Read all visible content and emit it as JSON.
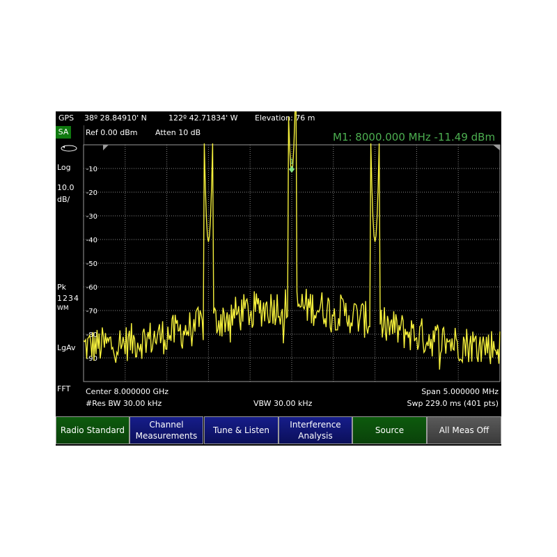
{
  "gps": {
    "label": "GPS",
    "lat": "38º 28.84910' N",
    "lon": "122º 42.71834' W",
    "elevation": "Elevation: 76 m"
  },
  "mode_badge": "SA",
  "header": {
    "ref": "Ref 0.00 dBm",
    "atten": "Atten 10 dB",
    "marker": "M1:  8000.000 MHz  -11.49 dBm"
  },
  "left_panel": {
    "scale_type": "Log",
    "scale_value": "10.0",
    "scale_unit": "dB/",
    "detector": "Pk",
    "traces": "1234",
    "trace_mode": "WM",
    "average": "LgAv",
    "sweep_type": "FFT"
  },
  "footer": {
    "center": "Center 8.000000 GHz",
    "span": "Span 5.000000 MHz",
    "rbw": "#Res BW 30.00 kHz",
    "vbw": "VBW 30.00 kHz",
    "sweep": "Swp 229.0 ms (401 pts)"
  },
  "softkeys": [
    {
      "label": "Radio Standard",
      "style": "green"
    },
    {
      "label": "Channel\nMeasurements",
      "style": "blue"
    },
    {
      "label": "Tune & Listen",
      "style": "blue"
    },
    {
      "label": "Interference\nAnalysis",
      "style": "blue"
    },
    {
      "label": "Source",
      "style": "green"
    },
    {
      "label": "All Meas Off",
      "style": "gray"
    }
  ],
  "colors": {
    "trace": "#f5f03c",
    "marker": "#7fdd7f",
    "grid": "#8a8a8a",
    "marker_text": "#4caf50"
  },
  "marker_id": "1",
  "chart_data": {
    "type": "line",
    "x_unit": "GHz",
    "xlim": [
      7.9975,
      8.0025
    ],
    "ylim": [
      -100,
      0
    ],
    "y_ticks": [
      -10,
      -20,
      -30,
      -40,
      -50,
      -60,
      -70,
      -80,
      -90
    ],
    "grid": true,
    "points": 401,
    "marker": {
      "x": 8.0,
      "y": -11.49
    },
    "peaks": [
      {
        "x": 7.999,
        "y": -41
      },
      {
        "x": 8.0,
        "y": -11.49
      },
      {
        "x": 8.001,
        "y": -41
      }
    ],
    "noise_floor_range": [
      -92,
      -60
    ]
  }
}
